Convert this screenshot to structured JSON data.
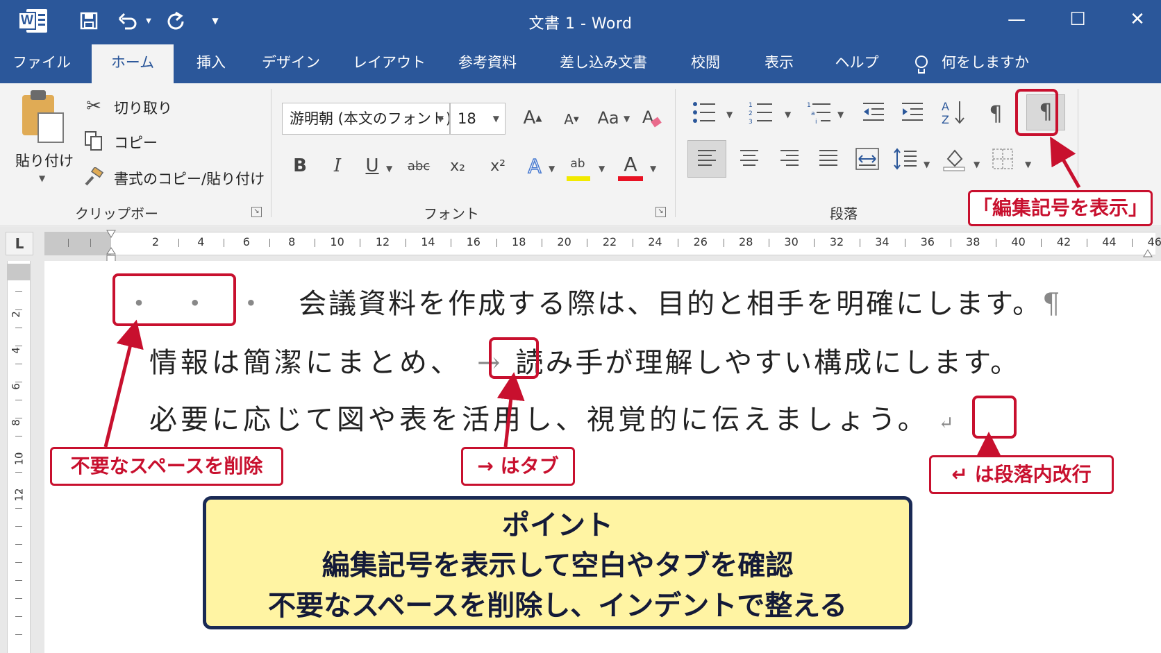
{
  "titlebar": {
    "title": "文書 1  -  Word",
    "minimize": "—",
    "maximize": "☐",
    "close": "✕",
    "logo_letter": "W"
  },
  "tabs": [
    "ファイル",
    "ホーム",
    "挿入",
    "デザイン",
    "レイアウト",
    "参考資料",
    "差し込み文書",
    "校閲",
    "表示",
    "ヘルプ"
  ],
  "active_tab": "ホーム",
  "tell_me": "何をしますか",
  "clipboard": {
    "paste": "貼り付け",
    "cut": "切り取り",
    "copy": "コピー",
    "format_painter": "書式のコピー/貼り付け",
    "group_label": "クリップボード"
  },
  "font": {
    "font_name": "游明朝 (本文のフォント)",
    "font_size": "18",
    "group_label": "フォント",
    "bold": "B",
    "italic": "I",
    "underline": "U",
    "strike": "abc",
    "subscript": "x₂",
    "superscript": "x²",
    "change_case": "Aa",
    "text_effects": "A",
    "highlight": "ab",
    "font_color": "A",
    "grow": "A",
    "shrink": "A"
  },
  "paragraph": {
    "group_label": "段落",
    "show_marks": "¶"
  },
  "ruler": {
    "tab_selector": "L",
    "numbers": [
      "2",
      "4",
      "6",
      "8",
      "10",
      "12",
      "14",
      "16",
      "18",
      "20",
      "22",
      "24",
      "26",
      "28",
      "30",
      "32",
      "34",
      "36",
      "38",
      "40",
      "42",
      "44",
      "46"
    ],
    "vertical_numbers": [
      "2",
      "4",
      "6",
      "8",
      "10",
      "12"
    ]
  },
  "document": {
    "line1_spaces": "・ ・ ・",
    "line1_text": "会議資料を作成する際は、目的と相手を明確にします。",
    "line1_mark": "¶",
    "line2_a": "情報は簡潔にまとめ、",
    "line2_tab": "→",
    "line2_b": "読み手が理解しやすい構成にします。",
    "line3_text": "必要に応じて図や表を活用し、視覚的に伝えましょう。",
    "line3_mark": "↵"
  },
  "callouts": {
    "show_marks": "「編集記号を表示」",
    "delete_spaces": "不要なスペースを削除",
    "tab": "→ はタブ",
    "line_break": "↵ は段落内改行"
  },
  "point": {
    "title": "ポイント",
    "line1": "編集記号を表示して空白やタブを確認",
    "line2": "不要なスペースを削除し、インデントで整える"
  },
  "colors": {
    "word_blue": "#2b579a",
    "callout_red": "#c8102e",
    "point_bg": "#fff4a3",
    "point_border": "#1a2a55"
  }
}
